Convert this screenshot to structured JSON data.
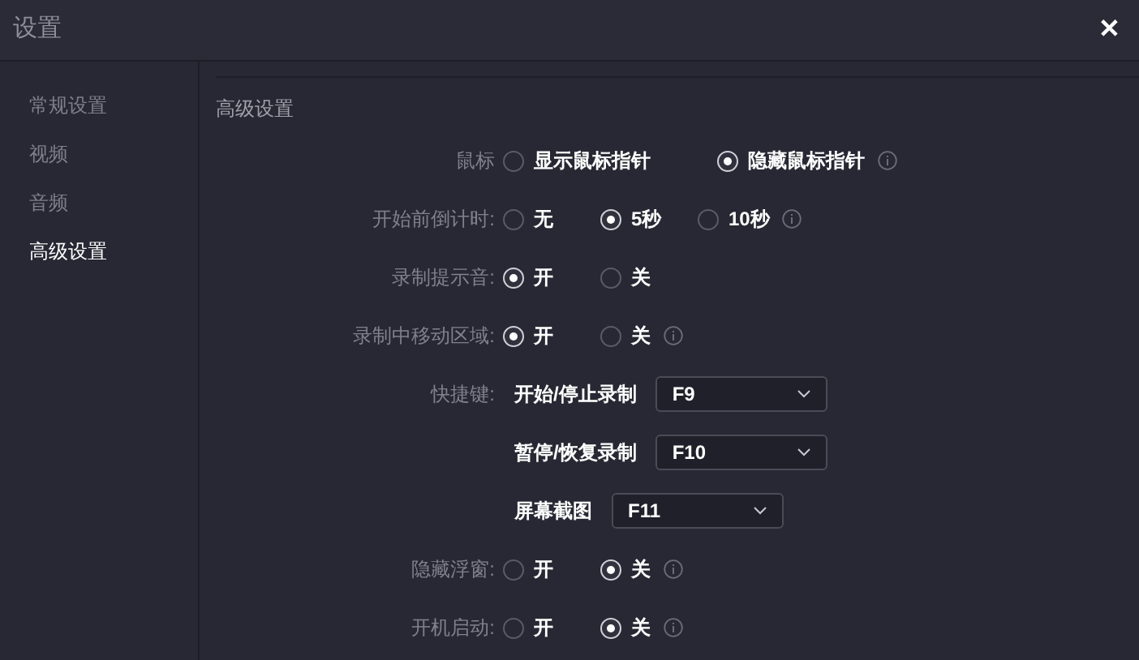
{
  "window": {
    "title": "设置",
    "close": "✕"
  },
  "sidebar": {
    "items": [
      {
        "label": "常规设置",
        "selected": false
      },
      {
        "label": "视频",
        "selected": false
      },
      {
        "label": "音频",
        "selected": false
      },
      {
        "label": "高级设置",
        "selected": true
      }
    ]
  },
  "section_title": "高级设置",
  "rows": [
    {
      "kind": "radio",
      "label": "鼠标",
      "info": true,
      "options": [
        {
          "label": "显示鼠标指针",
          "selected": false
        },
        {
          "label": "隐藏鼠标指针",
          "selected": true
        }
      ]
    },
    {
      "kind": "radio",
      "label": "开始前倒计时:",
      "info": true,
      "options": [
        {
          "label": "无",
          "selected": false
        },
        {
          "label": "5秒",
          "selected": true
        },
        {
          "label": "10秒",
          "selected": false
        }
      ]
    },
    {
      "kind": "radio",
      "label": "录制提示音:",
      "info": false,
      "options": [
        {
          "label": "开",
          "selected": true
        },
        {
          "label": "关",
          "selected": false
        }
      ]
    },
    {
      "kind": "radio",
      "label": "录制中移动区域:",
      "info": true,
      "options": [
        {
          "label": "开",
          "selected": true
        },
        {
          "label": "关",
          "selected": false
        }
      ]
    },
    {
      "kind": "shortcut",
      "label": "快捷键:",
      "action": "开始/停止录制",
      "value": "F9"
    },
    {
      "kind": "shortcut",
      "action": "暂停/恢复录制",
      "value": "F10"
    },
    {
      "kind": "shortcut",
      "action": "屏幕截图",
      "value": "F11"
    },
    {
      "kind": "radio",
      "label": "隐藏浮窗:",
      "info": true,
      "options": [
        {
          "label": "开",
          "selected": false
        },
        {
          "label": "关",
          "selected": true
        }
      ]
    },
    {
      "kind": "radio",
      "label": "开机启动:",
      "info": true,
      "options": [
        {
          "label": "开",
          "selected": false
        },
        {
          "label": "关",
          "selected": true
        }
      ]
    }
  ]
}
